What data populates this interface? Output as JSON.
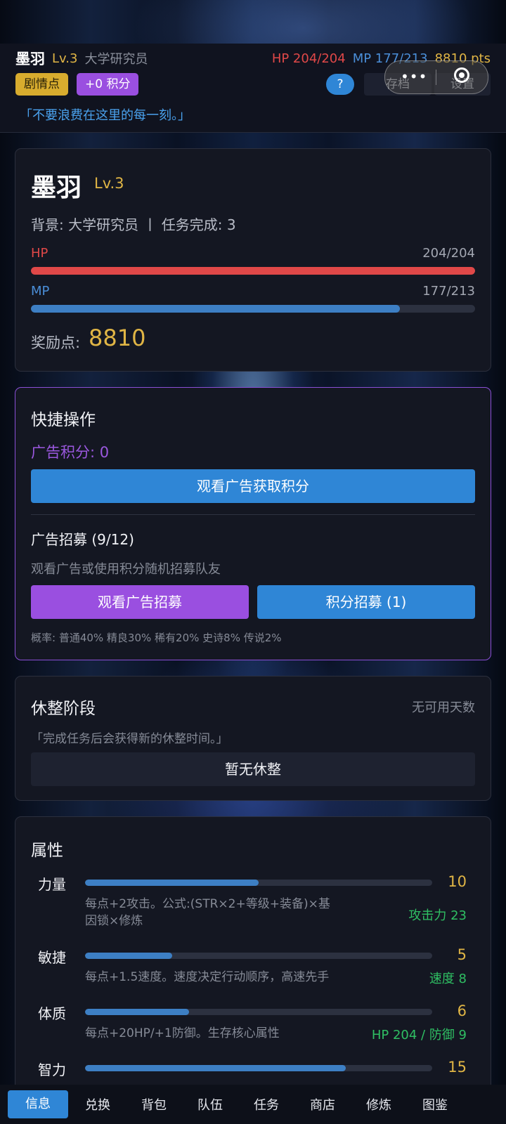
{
  "topbar": {
    "name": "墨羽",
    "level": "Lv.3",
    "background": "大学研究员",
    "hp": "HP 204/204",
    "mp": "MP 177/213",
    "points": "8810 pts",
    "story_chip": "剧情点",
    "score_chip": "+0 积分",
    "help": "?",
    "save": "存档",
    "settings": "设置",
    "capsule_dots": "•••"
  },
  "quote": "「不要浪费在这里的每一刻。」",
  "character": {
    "name": "墨羽",
    "level": "Lv.3",
    "background_line": "背景: 大学研究员 丨 任务完成: 3",
    "hp_label": "HP",
    "hp_value": "204/204",
    "hp_fraction": 1.0,
    "mp_label": "MP",
    "mp_value": "177/213",
    "mp_fraction": 0.831,
    "reward_label": "奖励点:",
    "reward_value": "8810",
    "colors": {
      "hp": "#e04848",
      "mp": "#3d7fc4",
      "gold": "#e0b545"
    }
  },
  "quick_actions": {
    "title": "快捷操作",
    "ad_score": "广告积分: 0",
    "watch_ad_button": "观看广告获取积分",
    "recruit_title": "广告招募 (9/12)",
    "recruit_desc": "观看广告或使用积分随机招募队友",
    "watch_ad_recruit_button": "观看广告招募",
    "score_recruit_button": "积分招募 (1)",
    "probability": "概率: 普通40% 精良30% 稀有20% 史诗8% 传说2%"
  },
  "rest": {
    "title": "休整阶段",
    "days": "无可用天数",
    "desc": "「完成任务后会获得新的休整时间。」",
    "button": "暂无休整"
  },
  "attributes": {
    "title": "属性",
    "items": [
      {
        "name": "力量",
        "value": "10",
        "fraction": 0.5,
        "desc": "每点+2攻击。公式:(STR×2+等级+装备)×基因锁×修炼",
        "effect": "攻击力 23"
      },
      {
        "name": "敏捷",
        "value": "5",
        "fraction": 0.25,
        "desc": "每点+1.5速度。速度决定行动顺序，高速先手",
        "effect": "速度 8"
      },
      {
        "name": "体质",
        "value": "6",
        "fraction": 0.3,
        "desc": "每点+20HP/+1防御。生存核心属性",
        "effect": "HP 204 / 防御 9"
      },
      {
        "name": "智力",
        "value": "15",
        "fraction": 0.75,
        "desc": "",
        "effect": ""
      }
    ]
  },
  "nav": [
    "信息",
    "兑换",
    "背包",
    "队伍",
    "任务",
    "商店",
    "修炼",
    "图鉴"
  ]
}
